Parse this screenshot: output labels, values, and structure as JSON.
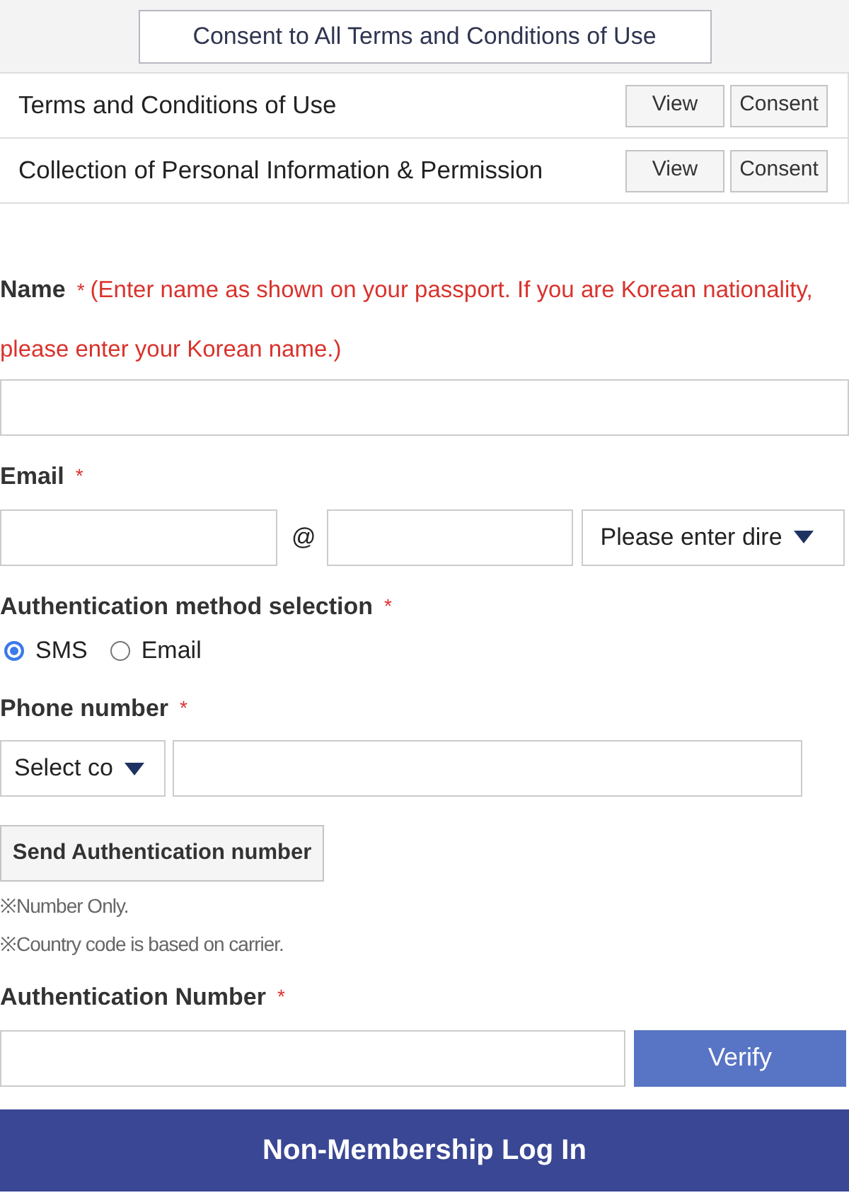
{
  "consent_all": {
    "label": "Consent to All Terms and Conditions of Use"
  },
  "terms": [
    {
      "title": "Terms and Conditions of Use",
      "buttons": [
        "View",
        "Consent"
      ]
    },
    {
      "title": "Collection of Personal Information & Permission",
      "buttons": [
        "View",
        "Consent"
      ]
    }
  ],
  "name": {
    "label": "Name",
    "required": "*",
    "note": "(Enter name as shown on your passport. If you are Korean nationality, please enter your Korean name.)"
  },
  "email": {
    "label": "Email",
    "required": "*",
    "at": "@",
    "domain_select": "Please enter dire"
  },
  "auth_method": {
    "label": "Authentication method selection",
    "required": "*",
    "options": [
      {
        "label": "SMS",
        "selected": true
      },
      {
        "label": "Email",
        "selected": false
      }
    ]
  },
  "phone": {
    "label": "Phone number",
    "required": "*",
    "country_select": "Select co"
  },
  "send_button": "Send Authentication number",
  "notes": [
    "※Number Only.",
    "※Country code is based on carrier."
  ],
  "auth_number": {
    "label": "Authentication Number",
    "required": "*",
    "verify_button": "Verify"
  },
  "login_button": "Non-Membership Log In"
}
